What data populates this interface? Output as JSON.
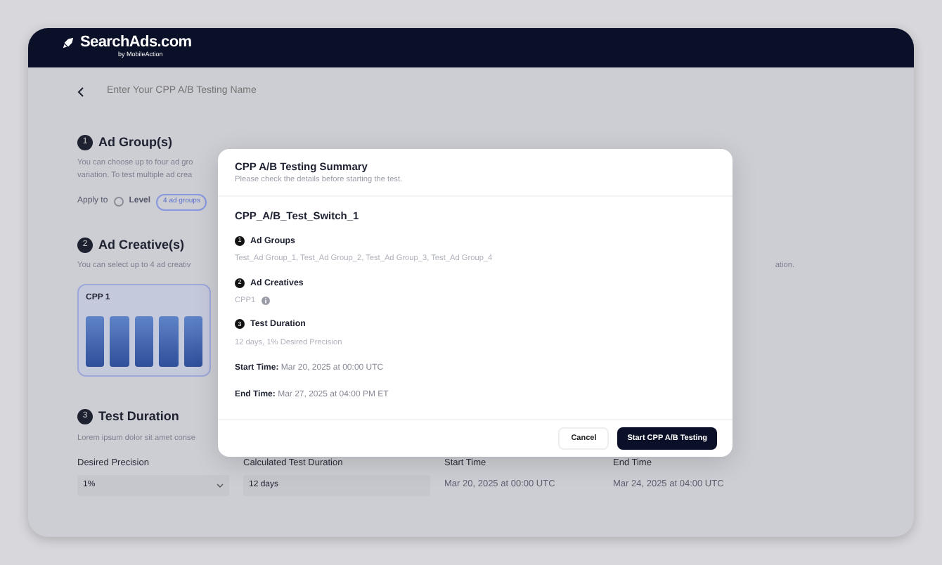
{
  "brand": {
    "name": "SearchAds.com",
    "byline": "by MobileAction"
  },
  "name_field": {
    "placeholder": "Enter Your CPP A/B Testing Name"
  },
  "ad_groups": {
    "number": "1",
    "title": "Ad Group(s)",
    "description_lines": [
      "You can choose up to four ad gro",
      "variation. To test multiple ad crea"
    ],
    "apply_to_label": "Apply to",
    "level_option": {
      "label": "Level",
      "selected": false
    },
    "badge": "4 ad groups"
  },
  "ad_creatives": {
    "number": "2",
    "title": "Ad Creative(s)",
    "description": "You can select up to 4 ad creativ",
    "description_end": "ation.",
    "card": {
      "title": "CPP 1"
    }
  },
  "test_duration": {
    "number": "3",
    "title": "Test Duration",
    "description": "Lorem ipsum dolor sit amet conse",
    "fields": [
      {
        "kind": "select",
        "label": "Desired Precision",
        "value": "1%"
      },
      {
        "kind": "input",
        "label": "Calculated Test Duration",
        "value": "12 days"
      },
      {
        "kind": "text",
        "label": "Start Time",
        "value": "Mar 20, 2025 at 00:00 UTC"
      },
      {
        "kind": "text",
        "label": "End Time",
        "value": "Mar 24, 2025 at 04:00 UTC"
      }
    ]
  },
  "modal": {
    "title": "CPP A/B Testing Summary",
    "subtitle": "Please check the details before starting the test.",
    "test_name": "CPP_A/B_Test_Switch_1",
    "items": [
      {
        "number": "1",
        "title": "Ad Groups",
        "value": "Test_Ad Group_1, Test_Ad Group_2, Test_Ad Group_3, Test_Ad Group_4",
        "info": false
      },
      {
        "number": "2",
        "title": "Ad Creatives",
        "value": "CPP1",
        "info": true
      },
      {
        "number": "3",
        "title": "Test Duration",
        "value": "12 days, 1% Desired Precision",
        "info": false
      }
    ],
    "times": [
      {
        "label": "Start Time:",
        "value": "Mar 20, 2025 at 00:00 UTC"
      },
      {
        "label": "End Time:",
        "value": "Mar 27, 2025 at 04:00 PM ET"
      }
    ],
    "buttons": [
      {
        "label": "Cancel",
        "kind": "secondary"
      },
      {
        "label": "Start CPP A/B Testing",
        "kind": "primary"
      }
    ]
  }
}
